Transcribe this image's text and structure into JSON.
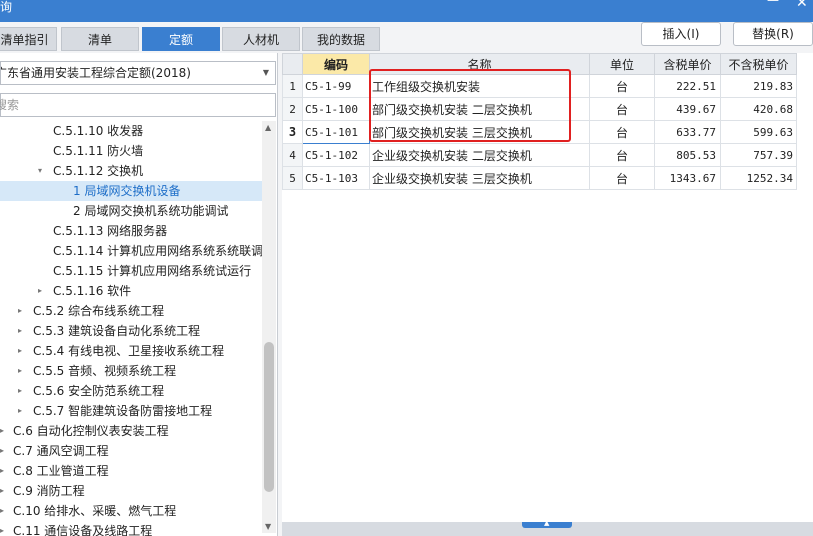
{
  "window": {
    "title": "询",
    "minimize_glyph": "—",
    "close_glyph": "✕"
  },
  "tabs": [
    {
      "label": "清单指引",
      "active": false
    },
    {
      "label": "清单",
      "active": false
    },
    {
      "label": "定额",
      "active": true
    },
    {
      "label": "人材机",
      "active": false
    },
    {
      "label": "我的数据",
      "active": false
    }
  ],
  "actions": {
    "insert_label": "插入(I)",
    "replace_label": "替换(R)"
  },
  "left": {
    "quota_library": "广东省通用安装工程综合定额(2018)",
    "search_placeholder": "搜索",
    "tree": [
      {
        "label": "C.5.1.10 收发器",
        "toggle": ""
      },
      {
        "label": "C.5.1.11 防火墙",
        "toggle": ""
      },
      {
        "label": "C.5.1.12 交换机",
        "toggle": "▾"
      },
      {
        "label": "1 局域网交换机设备",
        "toggle": "",
        "selected": true
      },
      {
        "label": "2 局域网交换机系统功能调试",
        "toggle": ""
      },
      {
        "label": "C.5.1.13 网络服务器",
        "toggle": ""
      },
      {
        "label": "C.5.1.14 计算机应用网络系统系统联调",
        "toggle": ""
      },
      {
        "label": "C.5.1.15 计算机应用网络系统试运行",
        "toggle": ""
      },
      {
        "label": "C.5.1.16 软件",
        "toggle": "▸"
      },
      {
        "label": "C.5.2 综合布线系统工程",
        "toggle": "▸"
      },
      {
        "label": "C.5.3 建筑设备自动化系统工程",
        "toggle": "▸"
      },
      {
        "label": "C.5.4 有线电视、卫星接收系统工程",
        "toggle": "▸"
      },
      {
        "label": "C.5.5 音频、视频系统工程",
        "toggle": "▸"
      },
      {
        "label": "C.5.6 安全防范系统工程",
        "toggle": "▸"
      },
      {
        "label": "C.5.7 智能建筑设备防雷接地工程",
        "toggle": "▸"
      },
      {
        "label": "C.6 自动化控制仪表安装工程",
        "toggle": "▸"
      },
      {
        "label": "C.7 通风空调工程",
        "toggle": "▸"
      },
      {
        "label": "C.8 工业管道工程",
        "toggle": "▸"
      },
      {
        "label": "C.9 消防工程",
        "toggle": "▸"
      },
      {
        "label": "C.10 给排水、采暖、燃气工程",
        "toggle": "▸"
      },
      {
        "label": "C.11 通信设备及线路工程",
        "toggle": "▸"
      }
    ]
  },
  "table": {
    "headers": {
      "code": "编码",
      "name": "名称",
      "unit": "单位",
      "price_tax": "含税单价",
      "price_notax": "不含税单价"
    },
    "rows": [
      {
        "n": "1",
        "code": "C5-1-99",
        "name": "工作组级交换机安装",
        "unit": "台",
        "price_tax": "222.51",
        "price_notax": "219.83"
      },
      {
        "n": "2",
        "code": "C5-1-100",
        "name": "部门级交换机安装 二层交换机",
        "unit": "台",
        "price_tax": "439.67",
        "price_notax": "420.68"
      },
      {
        "n": "3",
        "code": "C5-1-101",
        "name": "部门级交换机安装 三层交换机",
        "unit": "台",
        "price_tax": "633.77",
        "price_notax": "599.63"
      },
      {
        "n": "4",
        "code": "C5-1-102",
        "name": "企业级交换机安装 二层交换机",
        "unit": "台",
        "price_tax": "805.53",
        "price_notax": "757.39"
      },
      {
        "n": "5",
        "code": "C5-1-103",
        "name": "企业级交换机安装 三层交换机",
        "unit": "台",
        "price_tax": "1343.67",
        "price_notax": "1252.34"
      }
    ]
  },
  "colors": {
    "accent": "#3a7fd0",
    "highlight_box": "#e02020",
    "code_header": "#fbe9a8"
  }
}
